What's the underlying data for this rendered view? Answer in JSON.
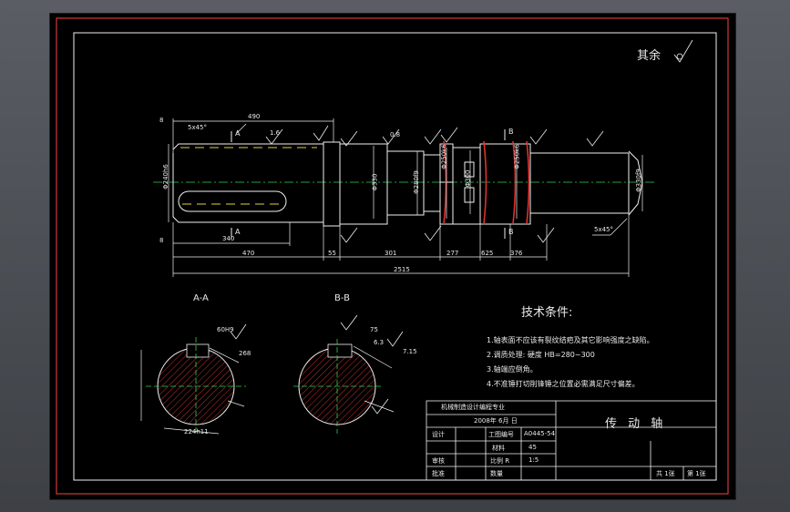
{
  "drawing": {
    "roughness_note": "其余",
    "section_a": "A-A",
    "section_b": "B-B",
    "cut_a_top": "A",
    "cut_a_bottom": "A",
    "cut_b_top": "B",
    "cut_b_bottom": "B",
    "dims": {
      "chamfer_left": "5x45°",
      "chamfer_right": "5x45°",
      "len_490": "490",
      "len_340": "340",
      "len_470": "470",
      "len_55": "55",
      "len_301": "301",
      "len_277": "277",
      "len_625": "625",
      "len_376": "376",
      "len_total": "2515",
      "d_left": "Φ240h6",
      "d_mid": "Φ330",
      "d_step": "Φ280f9",
      "d_ring1": "Φ250k6",
      "d_ring2": "Φ250k6",
      "d_center": "Φ300",
      "d_right": "Φ330f9",
      "edge_8_top": "8",
      "edge_8_bot": "8",
      "rough_16": "1.6",
      "rough_08": "0.8",
      "sec_a_60": "60H9",
      "sec_a_224": "224h11",
      "sec_a_268": "268",
      "sec_b_75": "75",
      "sec_b_63": "6.3",
      "sec_b_715": "7.15"
    }
  },
  "tech": {
    "title": "技术条件:",
    "items": [
      "1.轴表面不应该有裂纹结疤及其它影响强度之缺陷。",
      "2.调质处理: 硬度 HB=280~300",
      "3.轴端应倒角。",
      "4.不准锤打切削锋锤之位置必需满足尺寸偏差。"
    ]
  },
  "title_block": {
    "school": "机械制造设计编程专业",
    "date": "2008年 6月 日",
    "part_name": "传 动 轴",
    "drawing_no_label": "工图编号",
    "drawing_no": "A0445-54",
    "material_label": "材料",
    "material": "45",
    "scale_label": "比例 R",
    "scale": "1:5",
    "quantity_label": "数量",
    "designer": "设计",
    "checker": "审核",
    "approver": "批准",
    "sheet_total": "共 1张",
    "sheet_no": "第 1张"
  }
}
